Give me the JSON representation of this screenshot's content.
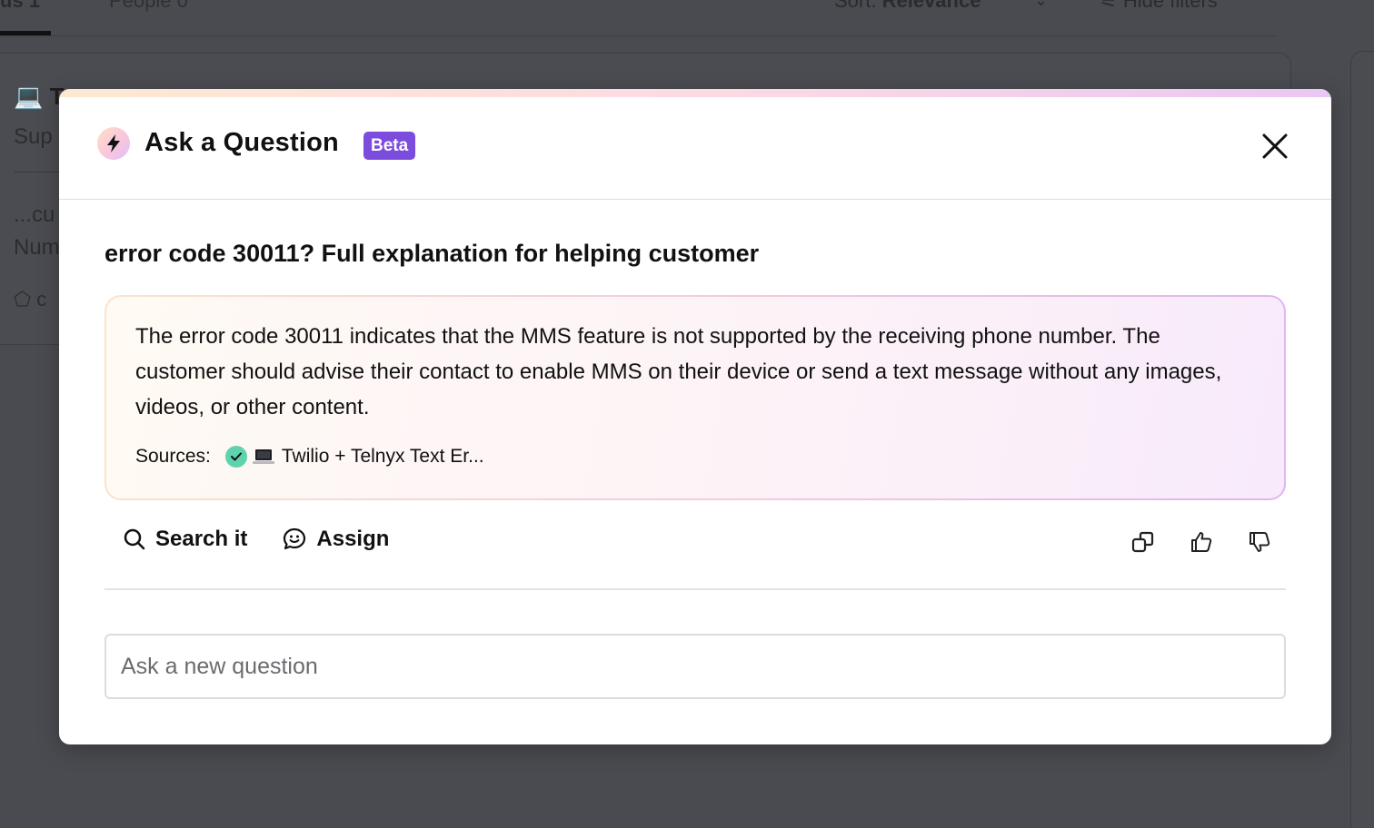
{
  "background": {
    "tabs": [
      {
        "label": "us 1"
      },
      {
        "label": "People 0"
      }
    ],
    "sort_label": "Sort:",
    "sort_value": "Relevance",
    "hide_filters_label": "Hide filters",
    "card": {
      "title": "T",
      "subtitle": "Sup",
      "snippet_line1": "...cu",
      "snippet_line2": "Num",
      "tag_text": "c"
    }
  },
  "modal": {
    "title": "Ask a Question",
    "badge": "Beta",
    "icons": {
      "title_icon": "lightning-bolt-icon",
      "close_icon": "close-icon"
    },
    "question": "error code 30011? Full explanation for helping customer",
    "answer": "The error code 30011 indicates that the MMS feature is not supported by the receiving phone number. The customer should advise their contact to enable MMS on their device or send a text message without any images, videos, or other content.",
    "sources": {
      "label": "Sources:",
      "items": [
        {
          "title": "Twilio + Telnyx Text Er...",
          "verified": true
        }
      ]
    },
    "actions": {
      "search_label": "Search it",
      "assign_label": "Assign"
    },
    "new_question": {
      "placeholder": "Ask a new question",
      "value": ""
    },
    "colors": {
      "badge": "#7c4ddd",
      "verified_check": "#5ed3ad",
      "gradient_start": "#fde9d2",
      "gradient_end": "#e9c7f3"
    }
  }
}
